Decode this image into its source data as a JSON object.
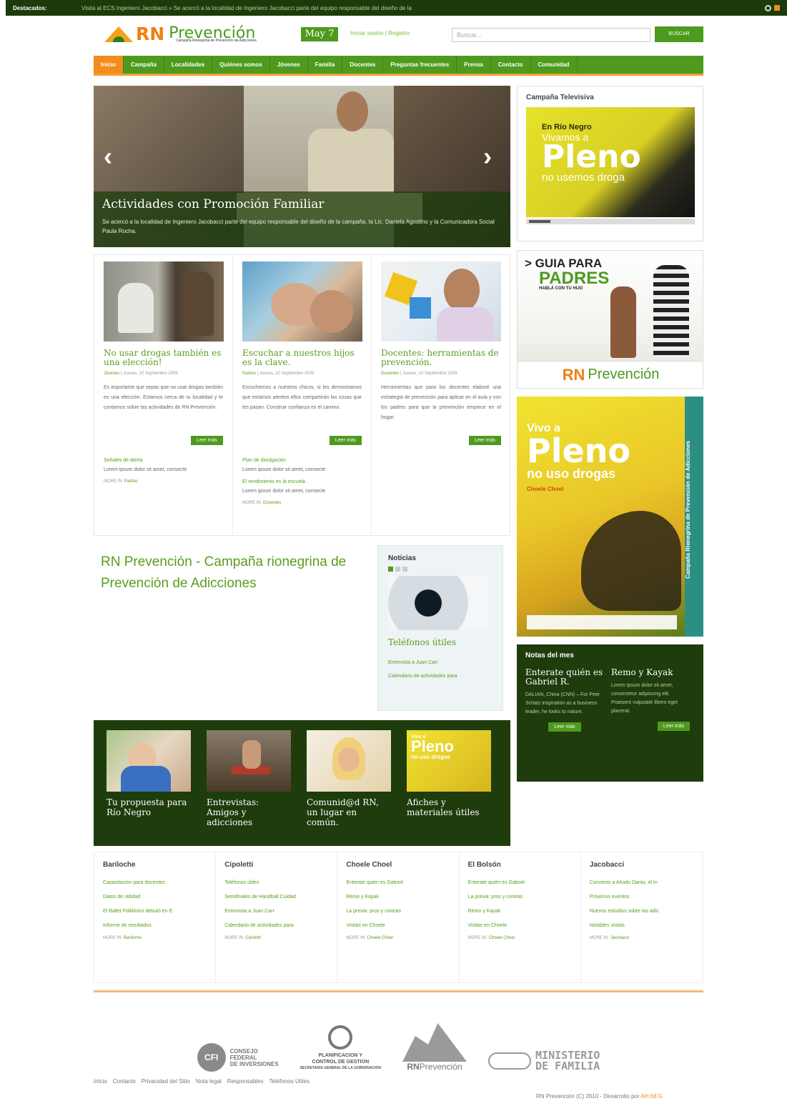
{
  "topbar": {
    "label": "Destacados:",
    "message": "Visita al ECS Ingeniero Jacobacci » Se acercó a la localidad de Ingeniero Jacobacci parte del equipo responsable del diseño de la"
  },
  "header": {
    "logo_rn": "RN",
    "logo_prev": "Prevención",
    "logo_tag": "Campaña Rionegrina de Prevención de Adicciones",
    "date": "May 7",
    "login": "Iniciar sesión | Registro",
    "search_placeholder": "Buscar...",
    "search_button": "BUSCAR"
  },
  "nav": [
    "Inicio",
    "Campaña",
    "Localidades",
    "Quiénes somos",
    "Jóvenes",
    "Familia",
    "Docentes",
    "Preguntas frecuentes",
    "Prensa",
    "Contacto",
    "Comunidad"
  ],
  "hero": {
    "title": "Actividades con Promoción Familiar",
    "text": "Se acercó a la localidad de Ingeniero Jacobacci parte del equipo responsable del diseño de la campaña, la Lic. Daniela Agostino y la Comunicadora Social Paula Rocha.",
    "prev": "‹",
    "next": "›"
  },
  "cards": [
    {
      "title": "No usar drogas también es una elección!",
      "cat": "Jóvenes",
      "date": "| Jueves, 10 Septiembre 2009",
      "body": "Es importante que sepas que no usar drogas también es una elección. Estamos cerca de tu localidad y te contamos sobre las actividades de RN Prevención.",
      "button": "Leer más",
      "sub1": "Señales de alerta",
      "subt1": "Lorem ipsum dolor sit amet, consecte",
      "sub2": "",
      "subt2": "",
      "more_label": "MORE IN:",
      "more_cat": "Padres"
    },
    {
      "title": "Escuchar a nuestros hijos es la clave.",
      "cat": "Padres",
      "date": "| Jueves, 10 Septiembre 2009",
      "body": "Escuchemos a nuestros chicos, si les demostramos que estamos atentos ellos compartirán las cosas que les pasan. Construir confianza es el camino.",
      "button": "Leer más",
      "sub1": "Plan de divulgación",
      "subt1": "Lorem ipsum dolor sit amet, consecte",
      "sub2": "El rendimiento en la escuela",
      "subt2": "Lorem ipsum dolor sit amet, consecte",
      "more_label": "MORE IN:",
      "more_cat": "Docentes"
    },
    {
      "title": "Docentes: herramientas de prevención.",
      "cat": "Docentes",
      "date": "| Jueves, 10 Septiembre 2009",
      "body": "Herramientas que para los docentes elaboré una estrategia de prevención para aplicar en el aula y con los padres para que la prevención empiece en el hogar.",
      "button": "Leer más",
      "sub1": "",
      "subt1": "",
      "sub2": "",
      "subt2": "",
      "more_label": "",
      "more_cat": ""
    }
  ],
  "campaign_title": "RN Prevención - Campaña rionegrina de Prevención de Adicciones",
  "noticias": {
    "title": "Noticias",
    "item_title": "Teléfonos útiles",
    "links": [
      "Entrevista a Juan Carr",
      "Calendario de actividades para"
    ]
  },
  "tv": {
    "title": "Campaña Televisiva",
    "line1": "En Río Negro",
    "line2": "Vivamos a",
    "line3": "Pleno",
    "line4": "no usemos droga"
  },
  "guia": {
    "line1": "> GUIA PARA",
    "line2": "PADRES",
    "line3": "HABLÁ CON TU HIJO",
    "foot_rn": "RN",
    "foot_prev": "Prevención"
  },
  "vivo": {
    "line1": "Vivo a",
    "line2": "Pleno",
    "line3": "no uso drogas",
    "line4": "Choele Choel",
    "side": "Campaña Rionegrina de Prevención de Adicciones"
  },
  "notas": {
    "title": "Notas del mes",
    "items": [
      {
        "title": "Enterate quién es Gabriel R.",
        "text": "DALIAN, China (CNN) – For Peer Schatz inspiration as a business leader, he looks to nature.",
        "button": "Leer más"
      },
      {
        "title": "Remo y Kayak",
        "text": "Lorem ipsum dolor sit amet, consectetur adipiscing elit. Praesent vulputate libero eget placerat.",
        "button": "Leer más"
      }
    ]
  },
  "features": [
    {
      "title": "Tu propuesta para Río Negro"
    },
    {
      "title": "Entrevistas: Amigos y adicciones"
    },
    {
      "title": "Comunid@d RN, un lugar en común."
    },
    {
      "title": "Afiches y materiales útiles",
      "badge1": "Vivo a",
      "badge2": "Pleno",
      "badge3": "no uso drogas"
    }
  ],
  "cities": [
    {
      "name": "Bariloche",
      "links": [
        "Capacitación para docentes",
        "Datos de utilidad",
        "El Ballet Folklórico debutó en E",
        "Informe de resultados"
      ],
      "more": "Bariloche"
    },
    {
      "name": "Cipoletti",
      "links": [
        "Teléfonos útiles",
        "Semifinales de Handball Cuidad",
        "Entrevista a Juan Carr",
        "Calendario de actividades para"
      ],
      "more": "Cipoletti"
    },
    {
      "name": "Choele Choel",
      "links": [
        "Enterate quién es Gabriel",
        "Remo y Kayak",
        "La previa: pros y contras",
        "Visitas en Choele"
      ],
      "more": "Choele Choel"
    },
    {
      "name": "El Bolsón",
      "links": [
        "Enterate quién es Gabriel",
        "La previa: pros y contras",
        "Remo y Kayak",
        "Visitas en Choele"
      ],
      "more": "Choele Choel"
    },
    {
      "name": "Jacobacci",
      "links": [
        "Convenio a Ahodo Danta, el In",
        "Próximos eventos",
        "Nuevos estudios sobre las adic",
        "Notables visitas"
      ],
      "more": "Jacobacci"
    }
  ],
  "more_label": "MORE IN:",
  "sponsors": {
    "cfi": "CFI",
    "cfi_text1": "CONSEJO",
    "cfi_text2": "FEDERAL",
    "cfi_text3": "DE INVERSIONES",
    "plan1": "PLANIFICACION Y",
    "plan2": "CONTROL DE GESTION",
    "plan3": "SECRETARIA GENERAL DE LA GOBERNACION",
    "rn": "RN",
    "rn_prev": "Prevención",
    "min1": "MINISTERIO",
    "min2": "DE FAMILIA"
  },
  "footer": {
    "links": [
      "Inicio",
      "Contacto",
      "Privacidad del Sitio",
      "Nota legal",
      "Responsables",
      "Teléfonos Útiles"
    ],
    "copy": "RN Prevención (C) 2010 - Desarrollo por",
    "author": "AH.68.G"
  },
  "colors": {
    "green": "#4e9a1e",
    "dark_green": "#1e3c0c",
    "orange": "#f28c1a"
  }
}
